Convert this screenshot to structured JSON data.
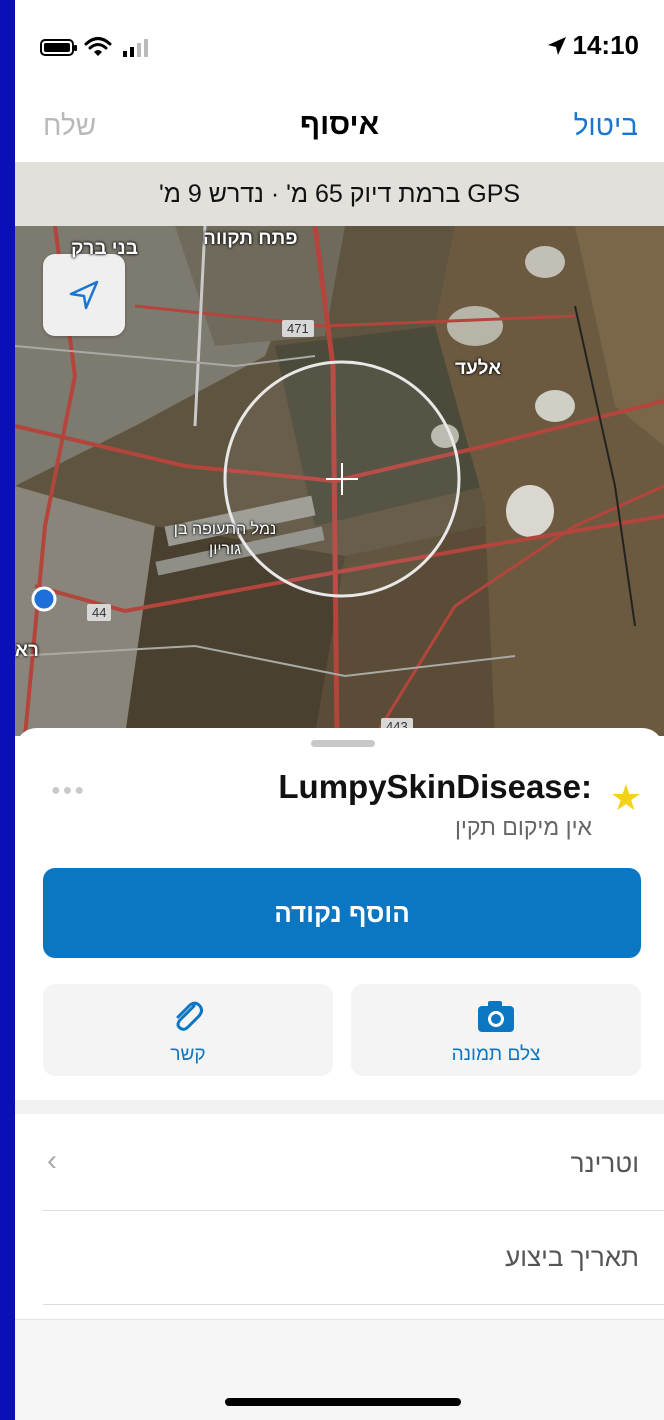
{
  "status_bar": {
    "time": "14:10"
  },
  "nav": {
    "send": "שלח",
    "title": "איסוף",
    "cancel": "ביטול"
  },
  "gps_banner": "GPS ברמת דיוק 65 מ' · נדרש 9 מ'",
  "map": {
    "labels": {
      "petah_tikva": "פתח תקווה",
      "bnei_brak": "בני ברק",
      "elad": "אלעד",
      "airport": "נמל התעופה בן גוריון",
      "rishon": "רא"
    },
    "roads": {
      "r471": "471",
      "r44": "44",
      "r443": "443"
    }
  },
  "sheet": {
    "layer_name": "LumpySkinDisease:",
    "layer_status": "אין מיקום תקין",
    "add_point": "הוסף נקודה",
    "take_photo": "צלם תמונה",
    "attach": "קשר",
    "rows": [
      {
        "label": "וטרינר"
      },
      {
        "label": "תאריך ביצוע"
      }
    ]
  },
  "colors": {
    "accent": "#0b77c3",
    "nav_cancel": "#1976d2",
    "star": "#f5d21a",
    "frame": "#0b0fb8"
  }
}
